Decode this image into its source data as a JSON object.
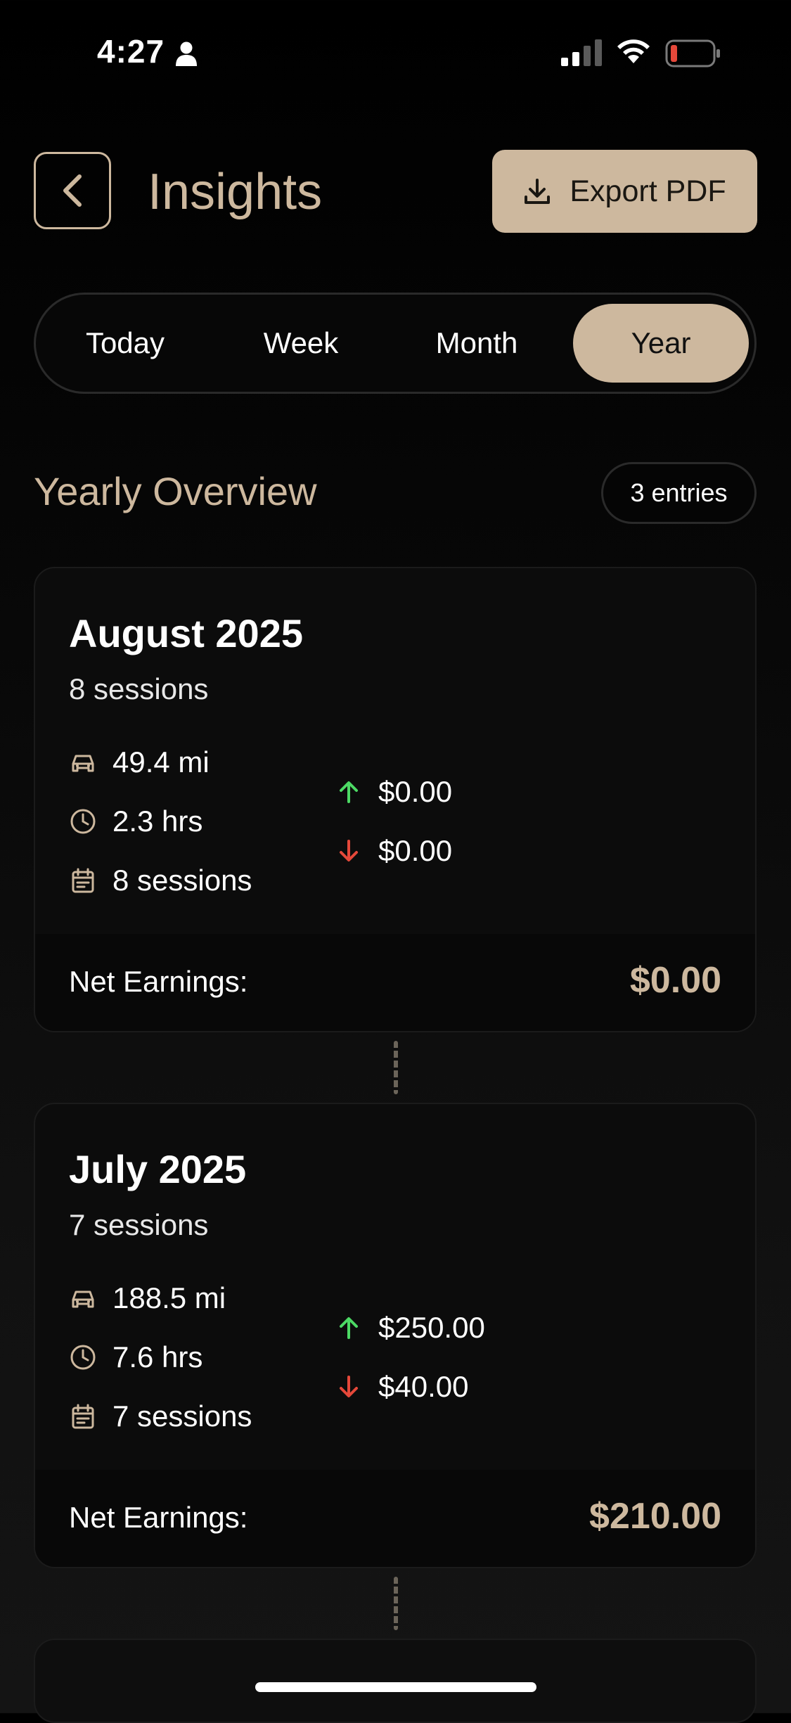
{
  "status_bar": {
    "time": "4:27"
  },
  "header": {
    "title": "Insights",
    "export_label": "Export PDF"
  },
  "tabs": [
    {
      "label": "Today",
      "active": false
    },
    {
      "label": "Week",
      "active": false
    },
    {
      "label": "Month",
      "active": false
    },
    {
      "label": "Year",
      "active": true
    }
  ],
  "section": {
    "title": "Yearly Overview",
    "entries": "3 entries"
  },
  "months": [
    {
      "title": "August 2025",
      "subtitle": "8 sessions",
      "distance": "49.4 mi",
      "hours": "2.3 hrs",
      "sessions": "8 sessions",
      "income": "$0.00",
      "expense": "$0.00",
      "net_label": "Net Earnings:",
      "net_value": "$0.00"
    },
    {
      "title": "July 2025",
      "subtitle": "7 sessions",
      "distance": "188.5 mi",
      "hours": "7.6 hrs",
      "sessions": "7 sessions",
      "income": "$250.00",
      "expense": "$40.00",
      "net_label": "Net Earnings:",
      "net_value": "$210.00"
    }
  ],
  "colors": {
    "accent": "#CDB89E",
    "income": "#4CD964",
    "expense": "#E5483A",
    "battery_low": "#E5483A"
  }
}
